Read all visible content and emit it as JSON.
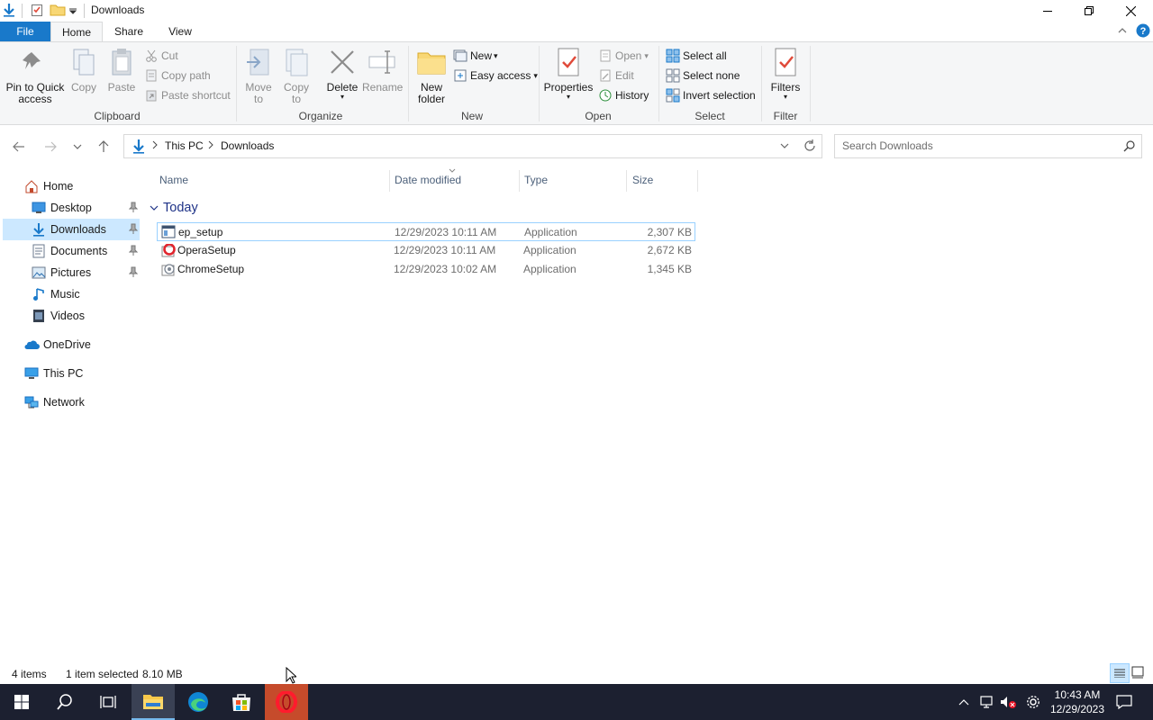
{
  "window": {
    "title": "Downloads"
  },
  "ribbon": {
    "tabs": {
      "file": "File",
      "home": "Home",
      "share": "Share",
      "view": "View"
    },
    "clipboard": {
      "label": "Clipboard",
      "pin_line1": "Pin to Quick",
      "pin_line2": "access",
      "copy": "Copy",
      "paste": "Paste",
      "cut": "Cut",
      "copy_path": "Copy path",
      "paste_shortcut": "Paste shortcut"
    },
    "organize": {
      "label": "Organize",
      "move_line1": "Move",
      "move_line2": "to",
      "copyto_line1": "Copy",
      "copyto_line2": "to",
      "delete": "Delete",
      "rename": "Rename"
    },
    "new": {
      "label": "New",
      "new_folder_line1": "New",
      "new_folder_line2": "folder",
      "new_item": "New",
      "easy_access": "Easy access"
    },
    "open": {
      "label": "Open",
      "properties": "Properties",
      "open": "Open",
      "edit": "Edit",
      "history": "History"
    },
    "select": {
      "label": "Select",
      "select_all": "Select all",
      "select_none": "Select none",
      "invert_selection": "Invert selection"
    },
    "filter": {
      "label": "Filter",
      "filters": "Filters"
    }
  },
  "address": {
    "crumbs": [
      "This PC",
      "Downloads"
    ],
    "search_placeholder": "Search Downloads"
  },
  "nav": {
    "items": [
      {
        "label": "Home"
      },
      {
        "label": "Desktop"
      },
      {
        "label": "Downloads"
      },
      {
        "label": "Documents"
      },
      {
        "label": "Pictures"
      },
      {
        "label": "Music"
      },
      {
        "label": "Videos"
      },
      {
        "label": "OneDrive"
      },
      {
        "label": "This PC"
      },
      {
        "label": "Network"
      }
    ]
  },
  "columns": {
    "name": "Name",
    "date": "Date modified",
    "type": "Type",
    "size": "Size"
  },
  "group": {
    "label": "Today"
  },
  "files": [
    {
      "name": "ep_setup",
      "date": "12/29/2023 10:11 AM",
      "type": "Application",
      "size": "2,307 KB"
    },
    {
      "name": "OperaSetup",
      "date": "12/29/2023 10:11 AM",
      "type": "Application",
      "size": "2,672 KB"
    },
    {
      "name": "ChromeSetup",
      "date": "12/29/2023 10:02 AM",
      "type": "Application",
      "size": "1,345 KB"
    }
  ],
  "status": {
    "items": "4 items",
    "selected": "1 item selected",
    "size": "8.10 MB"
  },
  "taskbar": {
    "time": "10:43 AM",
    "date": "12/29/2023"
  },
  "colors": {
    "accent": "#1979ca",
    "selection": "#cce8ff",
    "taskbar": "#1c2030"
  }
}
